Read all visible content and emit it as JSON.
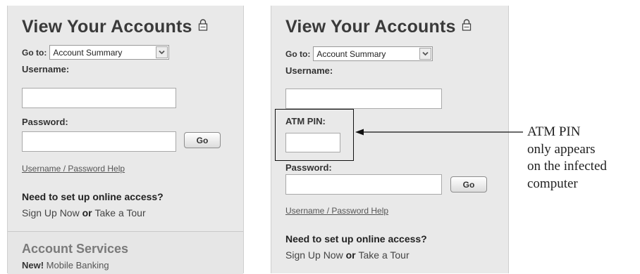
{
  "left_panel": {
    "title": "View Your Accounts",
    "goto_label": "Go to:",
    "goto_value": "Account Summary",
    "username_label": "Username:",
    "password_label": "Password:",
    "go_button": "Go",
    "help_link": "Username / Password Help",
    "setup_question": "Need to set up online access?",
    "signup_link": "Sign Up Now",
    "or_text": " or ",
    "tour_link": "Take a Tour",
    "services_title": "Account Services",
    "services_new": "New!",
    "services_item": " Mobile Banking"
  },
  "right_panel": {
    "title": "View Your Accounts",
    "goto_label": "Go to:",
    "goto_value": "Account Summary",
    "username_label": "Username:",
    "atm_pin_label": "ATM PIN:",
    "password_label": "Password:",
    "go_button": "Go",
    "help_link": "Username / Password Help",
    "setup_question": "Need to set up online access?",
    "signup_link": "Sign Up Now",
    "or_text": " or ",
    "tour_link": "Take a Tour"
  },
  "annotation": {
    "lines": [
      "ATM PIN",
      "only appears",
      "on the infected",
      "computer"
    ]
  },
  "icons": {
    "lock": "lock-icon",
    "dropdown": "chevron-down-icon"
  }
}
